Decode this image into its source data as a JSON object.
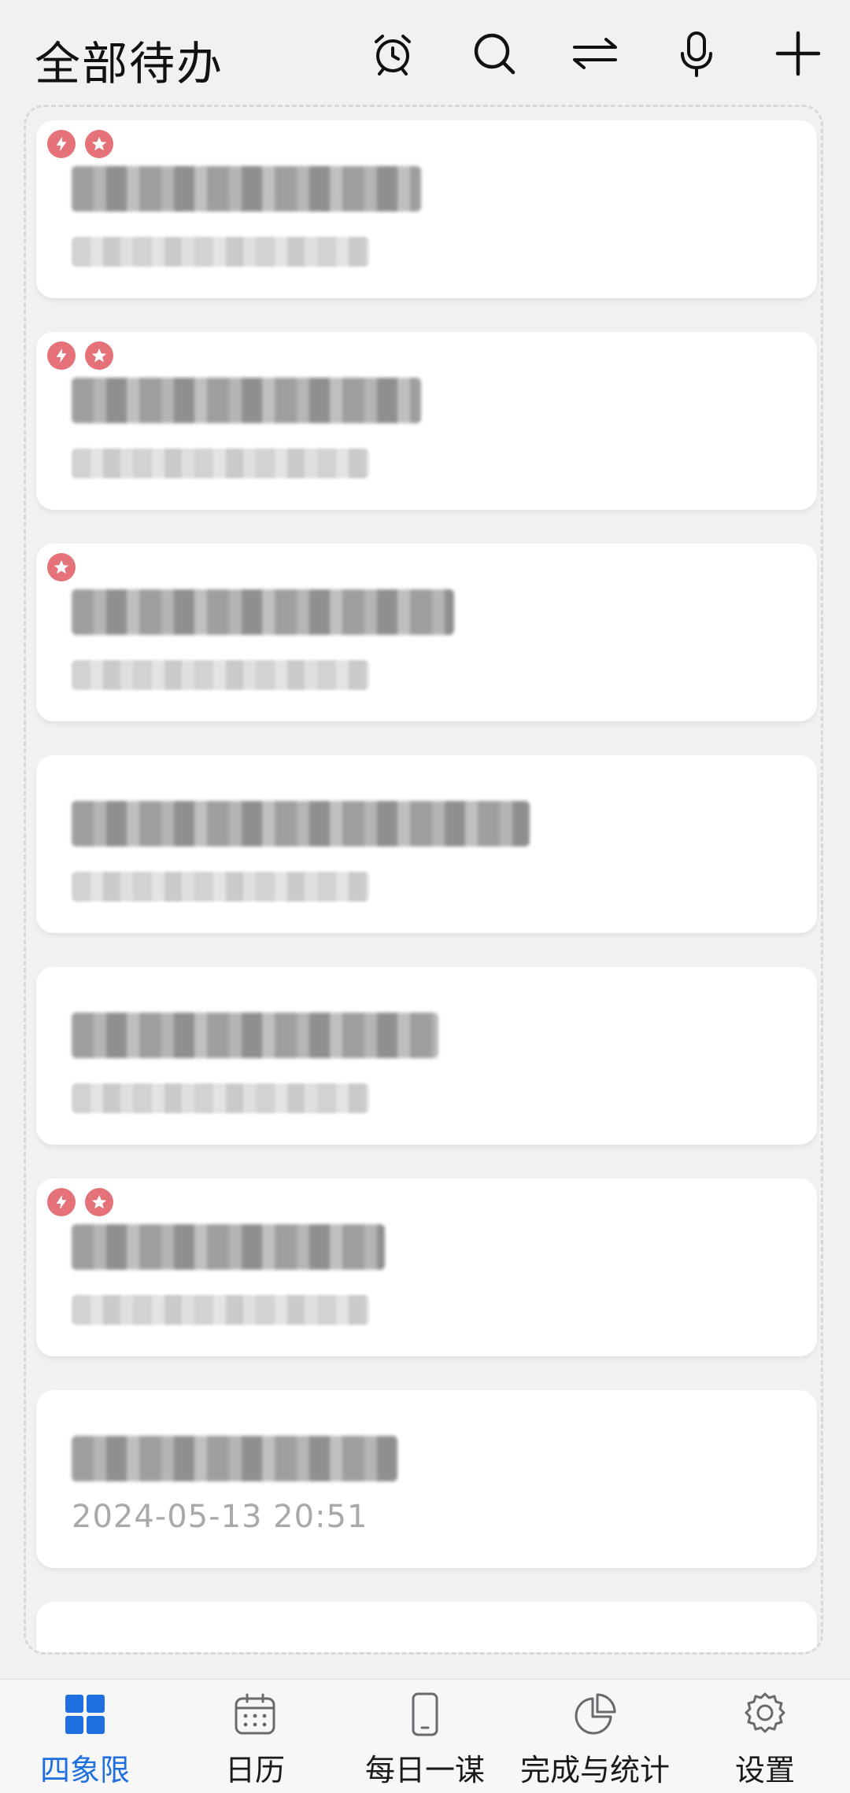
{
  "header": {
    "title": "全部待办",
    "icons": [
      "alarm-clock-icon",
      "search-icon",
      "swap-icon",
      "microphone-icon",
      "plus-icon"
    ]
  },
  "tasks": [
    {
      "badges": [
        "flash",
        "star"
      ],
      "title_blurred": true,
      "date_blurred": true
    },
    {
      "badges": [
        "flash",
        "star"
      ],
      "title_blurred": true,
      "date_blurred": true
    },
    {
      "badges": [
        "star"
      ],
      "title_blurred": true,
      "date_blurred": true
    },
    {
      "badges": [],
      "title_blurred": true,
      "date_blurred": true
    },
    {
      "badges": [],
      "title_blurred": true,
      "date_blurred": true
    },
    {
      "badges": [
        "flash",
        "star"
      ],
      "title_blurred": true,
      "date_blurred": true
    },
    {
      "badges": [],
      "title_blurred": true,
      "date": "2024-05-13 20:51"
    }
  ],
  "bottom_nav": {
    "items": [
      {
        "label": "四象限",
        "icon": "grid-icon",
        "active": true
      },
      {
        "label": "日历",
        "icon": "calendar-icon",
        "active": false
      },
      {
        "label": "每日一谋",
        "icon": "phone-icon",
        "active": false
      },
      {
        "label": "完成与统计",
        "icon": "pie-chart-icon",
        "active": false
      },
      {
        "label": "设置",
        "icon": "gear-icon",
        "active": false
      }
    ]
  },
  "colors": {
    "accent": "#1f6fe0",
    "badge": "#e47278",
    "background": "#f1f1f3",
    "card": "#ffffff"
  }
}
